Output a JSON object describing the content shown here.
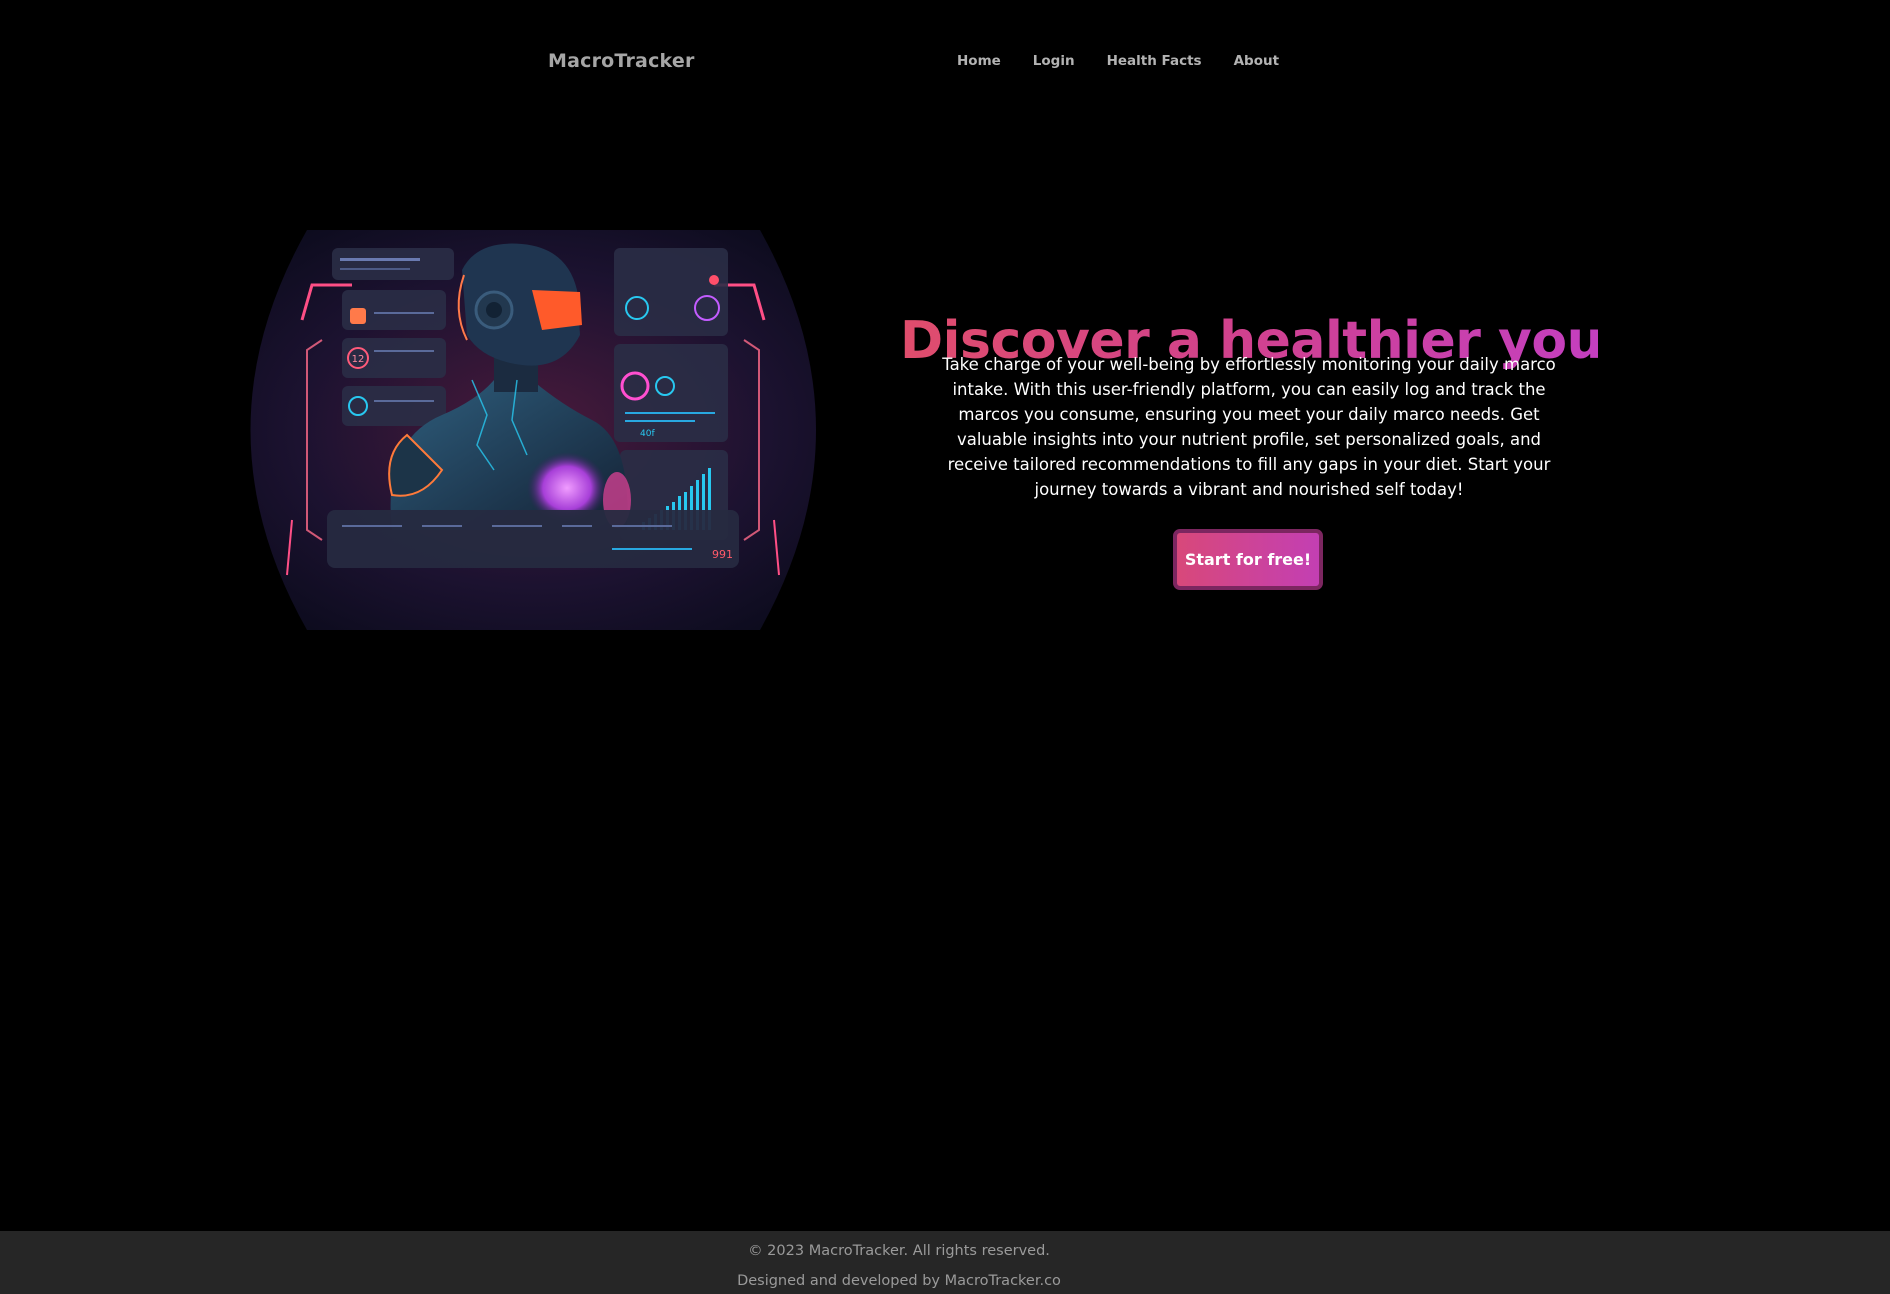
{
  "header": {
    "brand": "MacroTracker",
    "nav": [
      {
        "label": "Home"
      },
      {
        "label": "Login"
      },
      {
        "label": "Health Facts"
      },
      {
        "label": "About"
      }
    ]
  },
  "hero": {
    "title": "Discover a healthier you!",
    "description": "Take charge of your well-being by effortlessly monitoring your daily marco intake. With this user-friendly platform, you can easily log and track the marcos you consume, ensuring you meet your daily marco needs. Get valuable insights into your nutrient profile, set personalized goals, and receive tailored recommendations to fill any gaps in your diet. Start your journey towards a vibrant and nourished self today!",
    "cta_label": "Start for free!",
    "image_alt": "Futuristic armored figure surrounded by holographic health dashboards",
    "image_text": {
      "badge_value": "12",
      "stat_value": "40f",
      "readout_value": "991"
    }
  },
  "footer": {
    "copyright": "© 2023 MacroTracker. All rights reserved.",
    "credit": "Designed and developed by MacroTracker.co"
  },
  "colors": {
    "background": "#000000",
    "title_gradient_start": "#e04d6c",
    "title_gradient_end": "#c43fc0",
    "cta_background": "#d0438f",
    "cta_border": "#7c2660",
    "footer_background": "#262626",
    "neon_cyan": "#28c8f0",
    "neon_pink": "#ff4f86"
  }
}
